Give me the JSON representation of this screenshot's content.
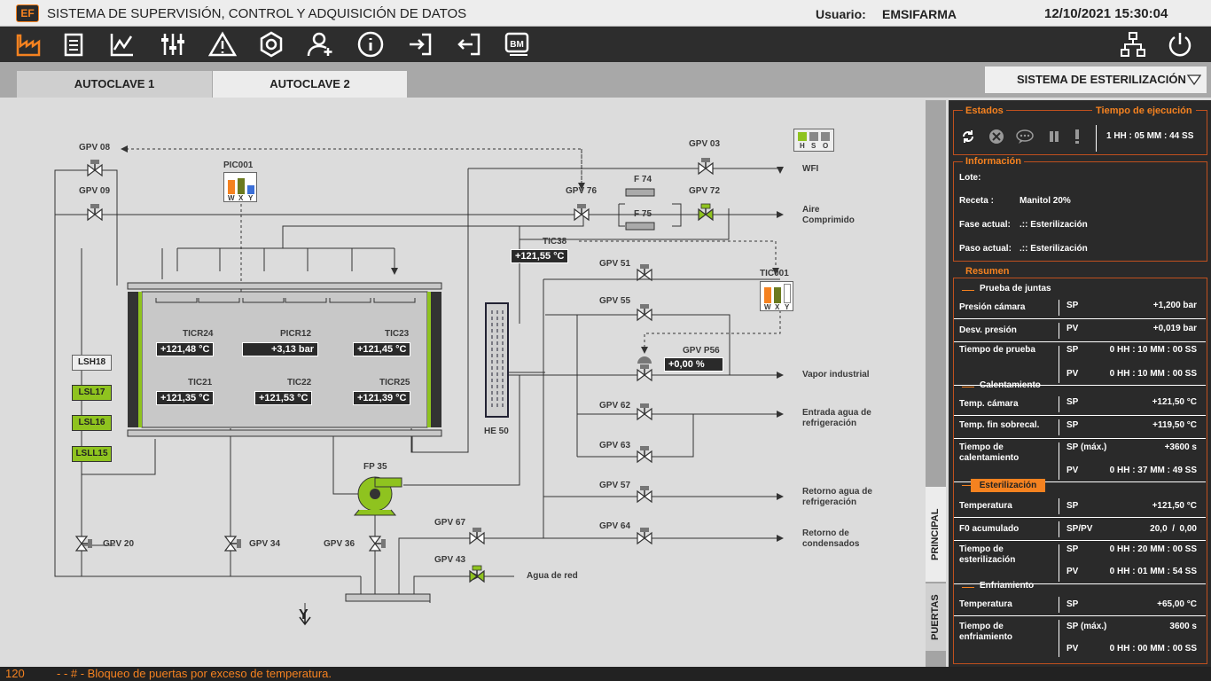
{
  "app": {
    "logo": "EF",
    "title": "SISTEMA DE SUPERVISIÓN, CONTROL Y ADQUISICIÓN DE DATOS",
    "user_label": "Usuario:",
    "user": "EMSIFARMA",
    "datetime": "12/10/2021 15:30:04"
  },
  "toolbar": {
    "icons": [
      "factory-icon",
      "clipboard-icon",
      "chart-icon",
      "sliders-icon",
      "warning-icon",
      "settings-icon",
      "add-user-icon",
      "info-icon",
      "login-icon",
      "logout-icon",
      "bm-icon",
      "network-icon",
      "power-icon"
    ],
    "bm_text": "BM"
  },
  "tabs": {
    "tab1": "AUTOCLAVE 1",
    "tab2": "AUTOCLAVE 2",
    "system": "SISTEMA DE ESTERILIZACIÓN"
  },
  "side_tabs": {
    "principal": "PRINCIPAL",
    "puertas": "PUERTAS"
  },
  "diagram": {
    "valves": {
      "gpv08": "GPV 08",
      "gpv09": "GPV 09",
      "gpv03": "GPV 03",
      "gpv76": "GPV 76",
      "gpv72": "GPV 72",
      "gpv51": "GPV 51",
      "gpv55": "GPV 55",
      "gpvp56": "GPV P56",
      "gpv62": "GPV 62",
      "gpv63": "GPV 63",
      "gpv57": "GPV 57",
      "gpv64": "GPV 64",
      "gpv67": "GPV 67",
      "gpv43": "GPV 43",
      "gpv20": "GPV 20",
      "gpv34": "GPV 34",
      "gpv36": "GPV 36"
    },
    "filters": {
      "f74": "F 74",
      "f75": "F 75"
    },
    "pic": {
      "name": "PIC001",
      "w": "W",
      "x": "X",
      "y": "Y"
    },
    "tic": {
      "name": "TIC001",
      "w": "W",
      "x": "X",
      "y": "Y"
    },
    "hso": {
      "h": "H",
      "s": "S",
      "o": "O"
    },
    "sensors": {
      "ticr24": {
        "name": "TICR24",
        "value": "+121,48 °C"
      },
      "picr12": {
        "name": "PICR12",
        "value": "+3,13 bar"
      },
      "tic23": {
        "name": "TIC23",
        "value": "+121,45 °C"
      },
      "tic21": {
        "name": "TIC21",
        "value": "+121,35 °C"
      },
      "tic22": {
        "name": "TIC22",
        "value": "+121,53 °C"
      },
      "ticr25": {
        "name": "TICR25",
        "value": "+121,39 °C"
      },
      "tic38": {
        "name": "TIC38",
        "value": "+121,55 °C"
      },
      "gpvp56": {
        "value": "+0,00 %"
      }
    },
    "levels": {
      "lsh18": "LSH18",
      "lsl17": "LSL17",
      "lsl16": "LSL16",
      "lsll15": "LSLL15"
    },
    "he": "HE 50",
    "pump": "FP 35",
    "drain": "Y",
    "lines": {
      "wfi": "WFI",
      "aire1": "Aire",
      "aire2": "Comprimido",
      "vapor": "Vapor industrial",
      "entrada1": "Entrada agua de",
      "entrada2": "refrigeración",
      "retorno1": "Retorno agua de",
      "retorno2": "refrigeración",
      "cond1": "Retorno de",
      "cond2": "condensados",
      "red": "Agua de red"
    }
  },
  "panel": {
    "estados": "Estados",
    "tiempo": "Tiempo de ejecución",
    "tiempo_val": "1 HH : 05 MM : 44 SS",
    "info": "Información",
    "lote": "Lote:",
    "receta_lbl": "Receta :",
    "receta": "Manitol 20%",
    "fase_lbl": "Fase actual:",
    "fase": ".:: Esterilización",
    "paso_lbl": "Paso actual:",
    "paso": ".:: Esterilización",
    "resumen": "Resumen",
    "prueba": "Prueba de juntas",
    "presion": "Presión cámara",
    "sp": "SP",
    "presion_v": "+1,200 bar",
    "desv": "Desv. presión",
    "pv": "PV",
    "desv_v": "+0,019 bar",
    "tprueba": "Tiempo de prueba",
    "tprueba_sp": "0 HH : 10 MM : 00 SS",
    "tprueba_pv": "0 HH : 10 MM : 00 SS",
    "calent": "Calentamiento",
    "tcam": "Temp. cámara",
    "tcam_v": "+121,50 °C",
    "tfin": "Temp. fin sobrecal.",
    "tfin_v": "+119,50 °C",
    "tcal1": "Tiempo de",
    "tcal2": "calentamiento",
    "spmax": "SP (máx.)",
    "tcal_sp": "+3600 s",
    "tcal_pv": "0 HH : 37 MM : 49 SS",
    "ester": "Esterilización",
    "temp": "Temperatura",
    "temp_v": "+121,50 °C",
    "f0": "F0 acumulado",
    "sppv": "SP/PV",
    "f0_v": "20,0  /  0,00",
    "test1": "Tiempo de",
    "test2": "esterilización",
    "test_sp": "0 HH : 20 MM : 00 SS",
    "test_pv": "0 HH : 01 MM : 54 SS",
    "enfr": "Enfriamiento",
    "tempe": "Temperatura",
    "tempe_v": "+65,00 °C",
    "tenf1": "Tiempo de",
    "tenf2": "enfriamiento",
    "tenf_sp": "3600 s",
    "tenf_pv": "0 HH : 00 MM : 00 SS"
  },
  "status": {
    "code": "120",
    "message": "- - # - Bloqueo de puertas por exceso de temperatura."
  }
}
